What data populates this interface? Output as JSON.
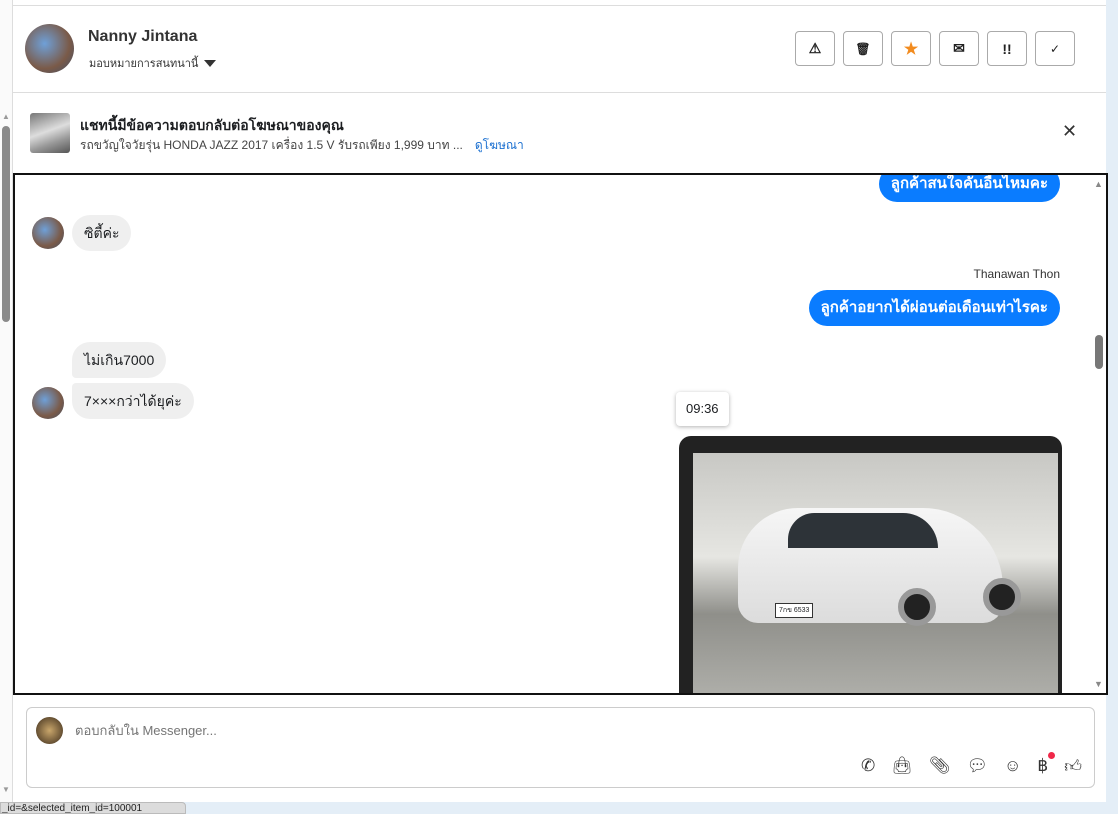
{
  "header": {
    "name": "Nanny Jintana",
    "assign_label": "มอบหมายการสนทนานี้",
    "actions": [
      {
        "icon": "warning-icon",
        "glyph": "⚠"
      },
      {
        "icon": "trash-icon",
        "glyph": "🗑"
      },
      {
        "icon": "star-icon",
        "glyph": "★",
        "color": "#f28b1e"
      },
      {
        "icon": "envelope-icon",
        "glyph": "✉"
      },
      {
        "icon": "priority-icon",
        "glyph": "!!"
      },
      {
        "icon": "check-icon",
        "glyph": "✓"
      }
    ]
  },
  "ad": {
    "title": "แชทนี้มีข้อความตอบกลับต่อโฆษณาของคุณ",
    "desc": "รถขวัญใจวัยรุ่น HONDA JAZZ 2017 เครื่อง 1.5 V รับรถเพียง 1,999 บาท ...",
    "link": "ดูโฆษณา"
  },
  "messages": {
    "out1": "ลูกค้าสนใจคันอื่นไหมคะ",
    "in1": "ซิตี้ค่ะ",
    "sender": "Thanawan Thon",
    "out2": "ลูกค้าอยากได้ผ่อนต่อเดือนเท่าไรคะ",
    "in2": "ไม่เกิน7000",
    "in3": "7×××กว่าได้ยุค่ะ",
    "time": "09:36",
    "plate": "7กข 6533"
  },
  "composer": {
    "placeholder": "ตอบกลับใน Messenger...",
    "tools": [
      "phone-plus-icon",
      "bag-icon",
      "paperclip-icon",
      "chat-bubble-icon",
      "smiley-icon",
      "baht-icon",
      "thumbs-up-icon"
    ],
    "accent": "#0a7cff"
  },
  "status_bar": "_id=&selected_item_id=100001"
}
